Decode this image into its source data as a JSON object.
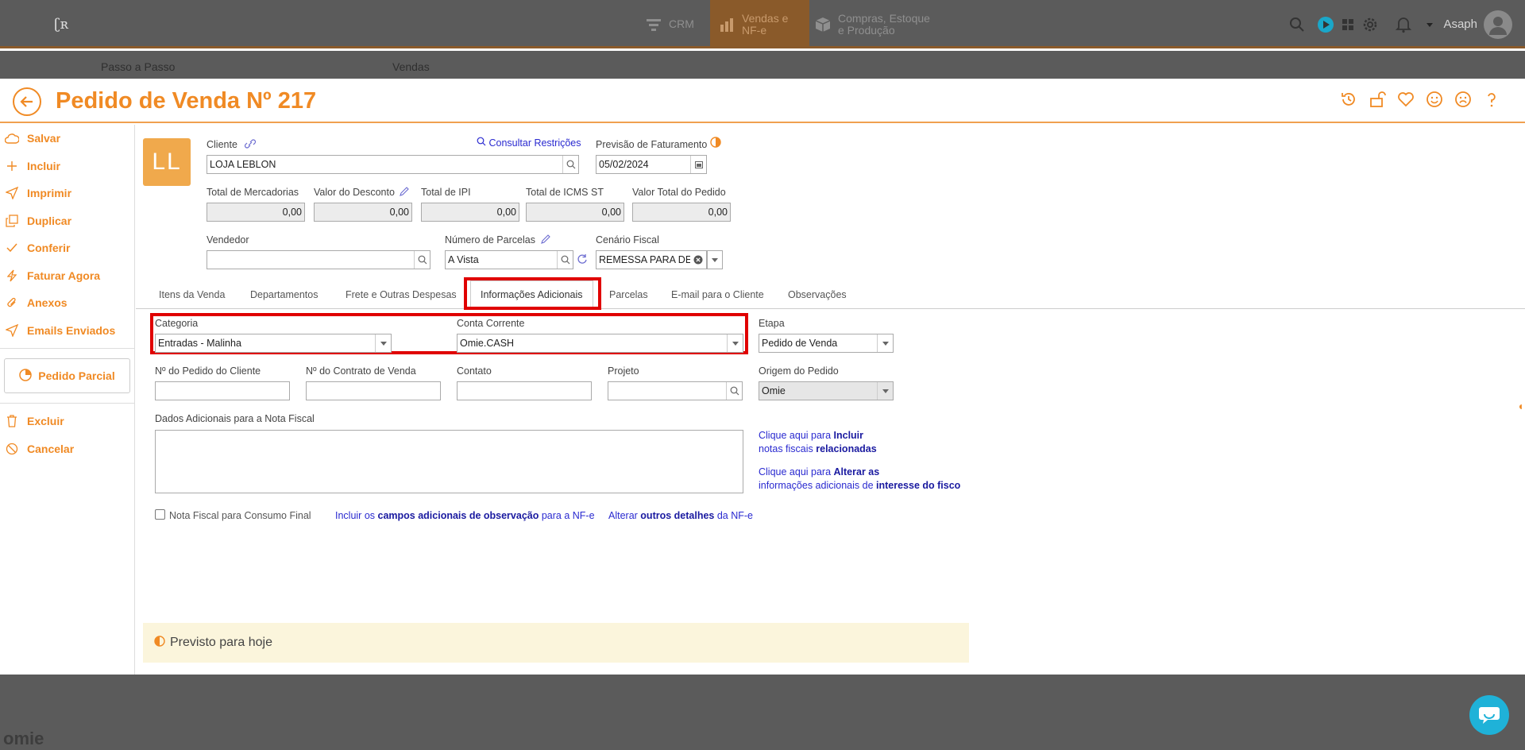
{
  "topbar": {
    "nav": [
      {
        "label": "CRM",
        "icon": "funnel-icon"
      },
      {
        "label": "Vendas e NF-e",
        "icon": "chart-icon"
      },
      {
        "label": "Compras, Estoque e Produção",
        "icon": "box-icon"
      }
    ],
    "user_name": "Asaph"
  },
  "subbar": {
    "left": "Passo a Passo",
    "middle": "Vendas"
  },
  "header": {
    "title": "Pedido de Venda Nº 217"
  },
  "sidebar": {
    "items": [
      {
        "label": "Salvar",
        "icon": "cloud-icon"
      },
      {
        "label": "Incluir",
        "icon": "plus-icon"
      },
      {
        "label": "Imprimir",
        "icon": "send-icon"
      },
      {
        "label": "Duplicar",
        "icon": "copy-icon"
      },
      {
        "label": "Conferir",
        "icon": "check-icon"
      },
      {
        "label": "Faturar Agora",
        "icon": "bolt-icon"
      },
      {
        "label": "Anexos",
        "icon": "paperclip-icon"
      },
      {
        "label": "Emails Enviados",
        "icon": "send-icon"
      }
    ],
    "pedido_parcial": "Pedido Parcial",
    "bottom_items": [
      {
        "label": "Excluir",
        "icon": "trash-icon"
      },
      {
        "label": "Cancelar",
        "icon": "ban-icon"
      }
    ]
  },
  "form": {
    "client_initials": "LL",
    "cliente_label": "Cliente",
    "cliente_value": "LOJA LEBLON",
    "consultar_restricoes": "Consultar Restrições",
    "previsao_label": "Previsão de Faturamento",
    "previsao_value": "05/02/2024",
    "totals": [
      {
        "label": "Total de Mercadorias",
        "value": "0,00"
      },
      {
        "label": "Valor do Desconto",
        "value": "0,00"
      },
      {
        "label": "Total de IPI",
        "value": "0,00"
      },
      {
        "label": "Total de ICMS ST",
        "value": "0,00"
      },
      {
        "label": "Valor Total do Pedido",
        "value": "0,00"
      }
    ],
    "vendedor_label": "Vendedor",
    "vendedor_value": "",
    "parcelas_label": "Número de Parcelas",
    "parcelas_value": "A Vista",
    "cenario_label": "Cenário Fiscal",
    "cenario_value": "REMESSA PARA DEMONS"
  },
  "tabs": [
    "Itens da Venda",
    "Departamentos",
    "Frete e Outras Despesas",
    "Informações Adicionais",
    "Parcelas",
    "E-mail para o Cliente",
    "Observações"
  ],
  "info": {
    "categoria_label": "Categoria",
    "categoria_value": "Entradas - Malinha",
    "conta_label": "Conta Corrente",
    "conta_value": "Omie.CASH",
    "etapa_label": "Etapa",
    "etapa_value": "Pedido de Venda",
    "pedido_cliente_label": "Nº do Pedido do Cliente",
    "contrato_label": "Nº do Contrato de Venda",
    "contato_label": "Contato",
    "projeto_label": "Projeto",
    "origem_label": "Origem do Pedido",
    "origem_value": "Omie",
    "dados_label": "Dados Adicionais para a Nota Fiscal",
    "link1_a": "Clique aqui para ",
    "link1_b": "Incluir",
    "link1_c": "notas fiscais ",
    "link1_d": "relacionadas",
    "link2_a": "Clique aqui para ",
    "link2_b": "Alterar as",
    "link2_c": "informações adicionais de ",
    "link2_d": "interesse do fisco",
    "consumo_final": "Nota Fiscal para Consumo Final",
    "incluir_a": "Incluir os ",
    "incluir_b": "campos adicionais de observação",
    "incluir_c": " para a NF-e",
    "alterar_a": "Alterar ",
    "alterar_b": "outros detalhes",
    "alterar_c": " da NF-e",
    "previsto": "Previsto para hoje"
  },
  "footer": {
    "logo": "omie"
  },
  "colors": {
    "accent": "#f08a24",
    "highlight": "#e00000",
    "link": "#2a2ad0"
  }
}
